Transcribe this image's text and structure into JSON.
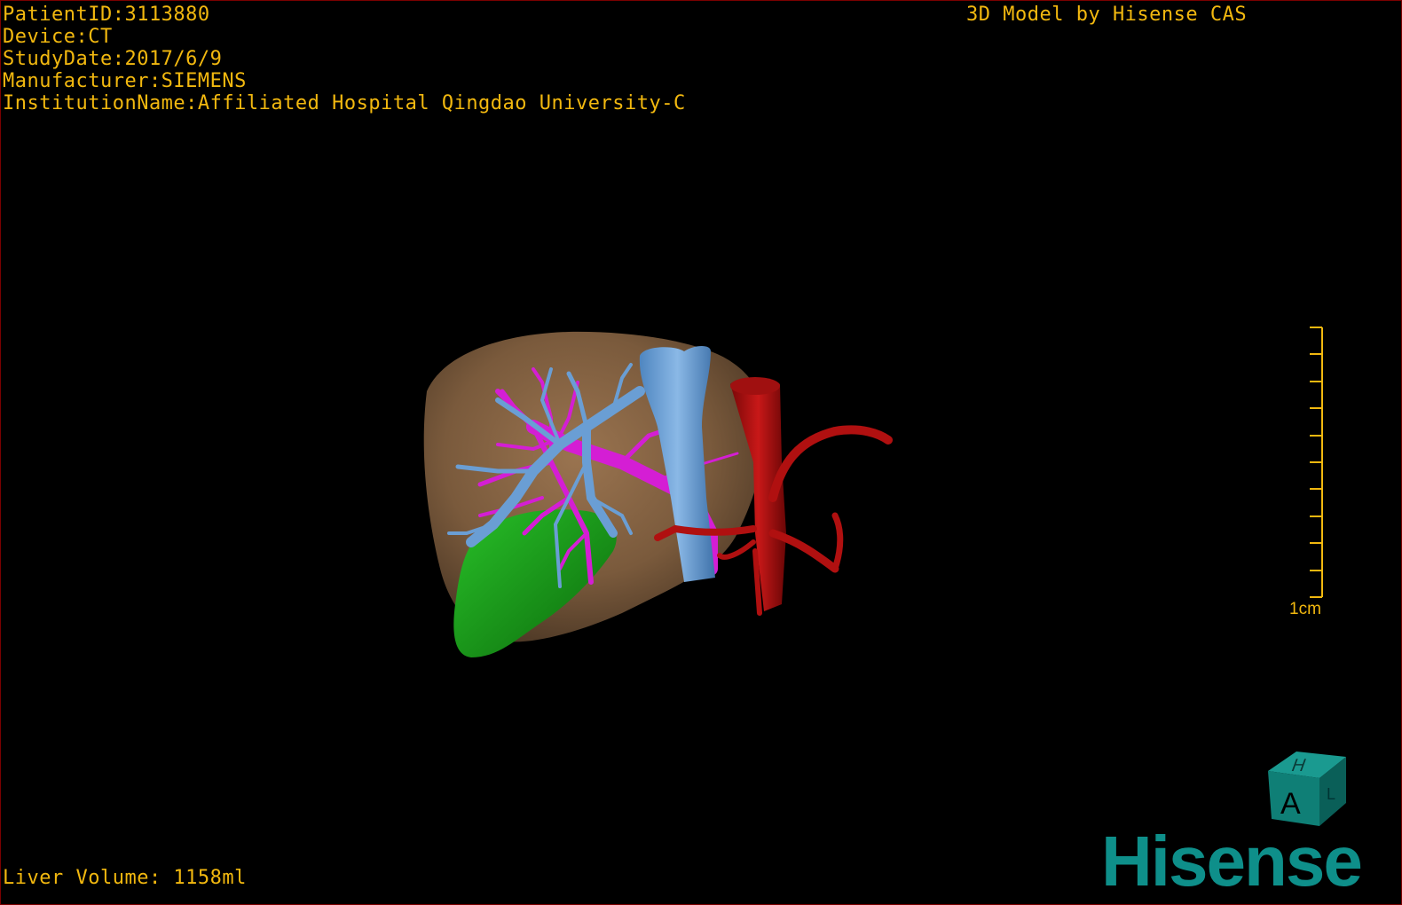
{
  "overlay": {
    "patient_id": "PatientID:3113880",
    "device": "Device:CT",
    "study_date": "StudyDate:2017/6/9",
    "manufacturer": "Manufacturer:SIEMENS",
    "institution": "InstitutionName:Affiliated Hospital Qingdao University-C"
  },
  "watermark": "3D Model by Hisense CAS",
  "liver_volume": "Liver Volume: 1158ml",
  "scale": {
    "label": "1cm"
  },
  "orientation_cube": {
    "front_label": "A",
    "top_label": "H",
    "side_label": "L"
  },
  "brand": "Hisense",
  "colors": {
    "overlay_text": "#f2b80f",
    "liver": "#7a5a3c",
    "portal_vein": "#6a9ed4",
    "hepatic_vein": "#d41ed4",
    "artery": "#b01010",
    "gallbladder": "#1aa01a",
    "brand": "#0e8f8a"
  }
}
